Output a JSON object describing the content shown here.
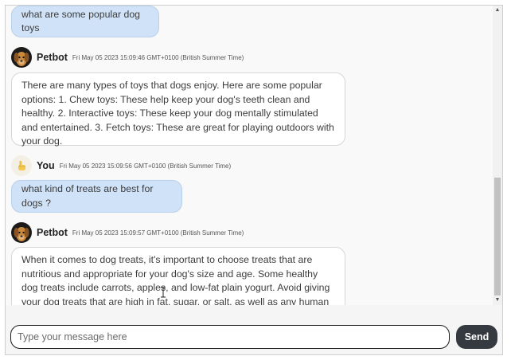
{
  "messages": [
    {
      "type": "user",
      "text": "what are some popular dog toys"
    },
    {
      "type": "bot",
      "sender": "Petbot",
      "timestamp": "Fri May 05 2023 15:09:46 GMT+0100 (British Summer Time)",
      "text": "There are many types of toys that dogs enjoy. Here are some popular options: 1. Chew toys: These help keep your dog's teeth clean and healthy. 2. Interactive toys: These keep your dog mentally stimulated and entertained. 3. Fetch toys: These are great for playing outdoors with your dog."
    },
    {
      "type": "user",
      "sender": "You",
      "timestamp": "Fri May 05 2023 15:09:56 GMT+0100 (British Summer Time)",
      "text": "what kind of treats are best for dogs ?"
    },
    {
      "type": "bot",
      "sender": "Petbot",
      "timestamp": "Fri May 05 2023 15:09:57 GMT+0100 (British Summer Time)",
      "text": "When it comes to dog treats, it's important to choose treats that are nutritious and appropriate for your dog's size and age. Some healthy dog treats include carrots, apples, and low-fat plain yogurt. Avoid giving your dog treats that are high in fat, sugar, or salt, as well as any human food that can be harmful to"
    }
  ],
  "input": {
    "placeholder": "Type your message here",
    "value": ""
  },
  "send_button": {
    "label": "Send",
    "color": "#343a40"
  },
  "colors": {
    "user_bubble": "#cfe2f7",
    "bot_bubble": "#ffffff"
  },
  "icons": {
    "bot_avatar": "dog-avatar-icon",
    "user_avatar": "pointing-hand-icon"
  }
}
